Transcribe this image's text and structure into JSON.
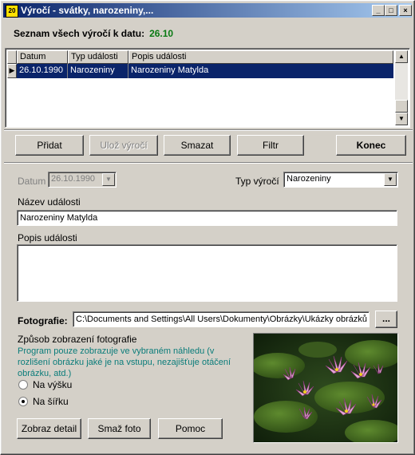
{
  "window": {
    "title": "Výročí - svátky, narozeniny,...",
    "icon_label": "20",
    "controls": [
      "minimize-icon",
      "maximize-icon",
      "close-icon"
    ]
  },
  "header": {
    "label": "Seznam všech výročí k datu:",
    "value": "26.10",
    "value_color": "#0a7a14"
  },
  "table": {
    "columns": [
      "Datum",
      "Typ události",
      "Popis události"
    ],
    "rows": [
      {
        "date": "26.10.1990",
        "type": "Narozeniny",
        "description": "Narozeniny Matylda",
        "selected": true
      }
    ]
  },
  "toolbar": {
    "add": "Přidat",
    "save": "Ulož výročí",
    "delete": "Smazat",
    "filter": "Filtr",
    "end": "Konec"
  },
  "form": {
    "date_label": "Datum",
    "date_value": "26.10.1990",
    "type_label": "Typ výročí",
    "type_value": "Narozeniny",
    "name_label": "Název události",
    "name_value": "Narozeniny Matylda",
    "desc_label": "Popis události",
    "desc_value": "",
    "photo_label": "Fotografie:",
    "photo_path": "C:\\Documents and Settings\\All Users\\Dokumenty\\Obrázky\\Ukázky obrázků",
    "browse": "...",
    "display_mode_label": "Způsob zobrazení fotografie",
    "hint": "Program pouze zobrazuje ve vybraném náhledu (v rozlišení obrázku jaké je na vstupu, nezajišťuje otáčení obrázku, atd.)",
    "hint_color": "#0a7c7a",
    "radio_height": "Na výšku",
    "radio_width": "Na šířku",
    "selected_mode": "Na šířku",
    "detail_button": "Zobraz detail",
    "delete_photo_button": "Smaž foto",
    "help_button": "Pomoc"
  },
  "colors": {
    "window_bg": "#d4d0c8",
    "title_start": "#0a246a",
    "title_end": "#a6caf0",
    "selection": "#0a246a"
  }
}
